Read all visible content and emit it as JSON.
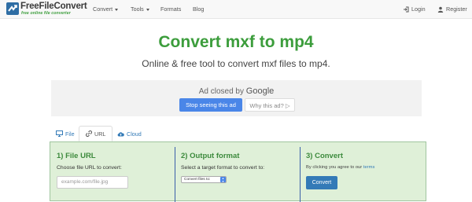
{
  "brand": {
    "name": "FreeFileConvert",
    "tagline": "free online file converter"
  },
  "nav": {
    "convert": "Convert",
    "tools": "Tools",
    "formats": "Formats",
    "blog": "Blog",
    "login": "Login",
    "register": "Register"
  },
  "hero": {
    "title": "Convert mxf to mp4",
    "subtitle": "Online & free tool to convert mxf files to mp4."
  },
  "ad": {
    "closed_by": "Ad closed by",
    "google": "Google",
    "stop_button": "Stop seeing this ad",
    "why_button": "Why this ad? ▷"
  },
  "tabs": [
    {
      "label": "File",
      "icon": "monitor-icon"
    },
    {
      "label": "URL",
      "icon": "link-icon"
    },
    {
      "label": "Cloud",
      "icon": "cloud-upload-icon"
    }
  ],
  "panel": {
    "step1": {
      "title": "1) File URL",
      "label": "Choose file URL to convert:",
      "placeholder": "example.com/file.jpg"
    },
    "step2": {
      "title": "2) Output format",
      "label": "Select a target format to convert to:",
      "select_value": "Convert files to:"
    },
    "step3": {
      "title": "3) Convert",
      "agree_text": "By clicking you agree to our",
      "terms_link": "terms",
      "button": "Convert"
    }
  },
  "colors": {
    "accent_green": "#3c9d3c",
    "panel_bg": "#dff0d8",
    "primary_blue": "#337ab7",
    "ad_blue": "#4a86e8"
  }
}
